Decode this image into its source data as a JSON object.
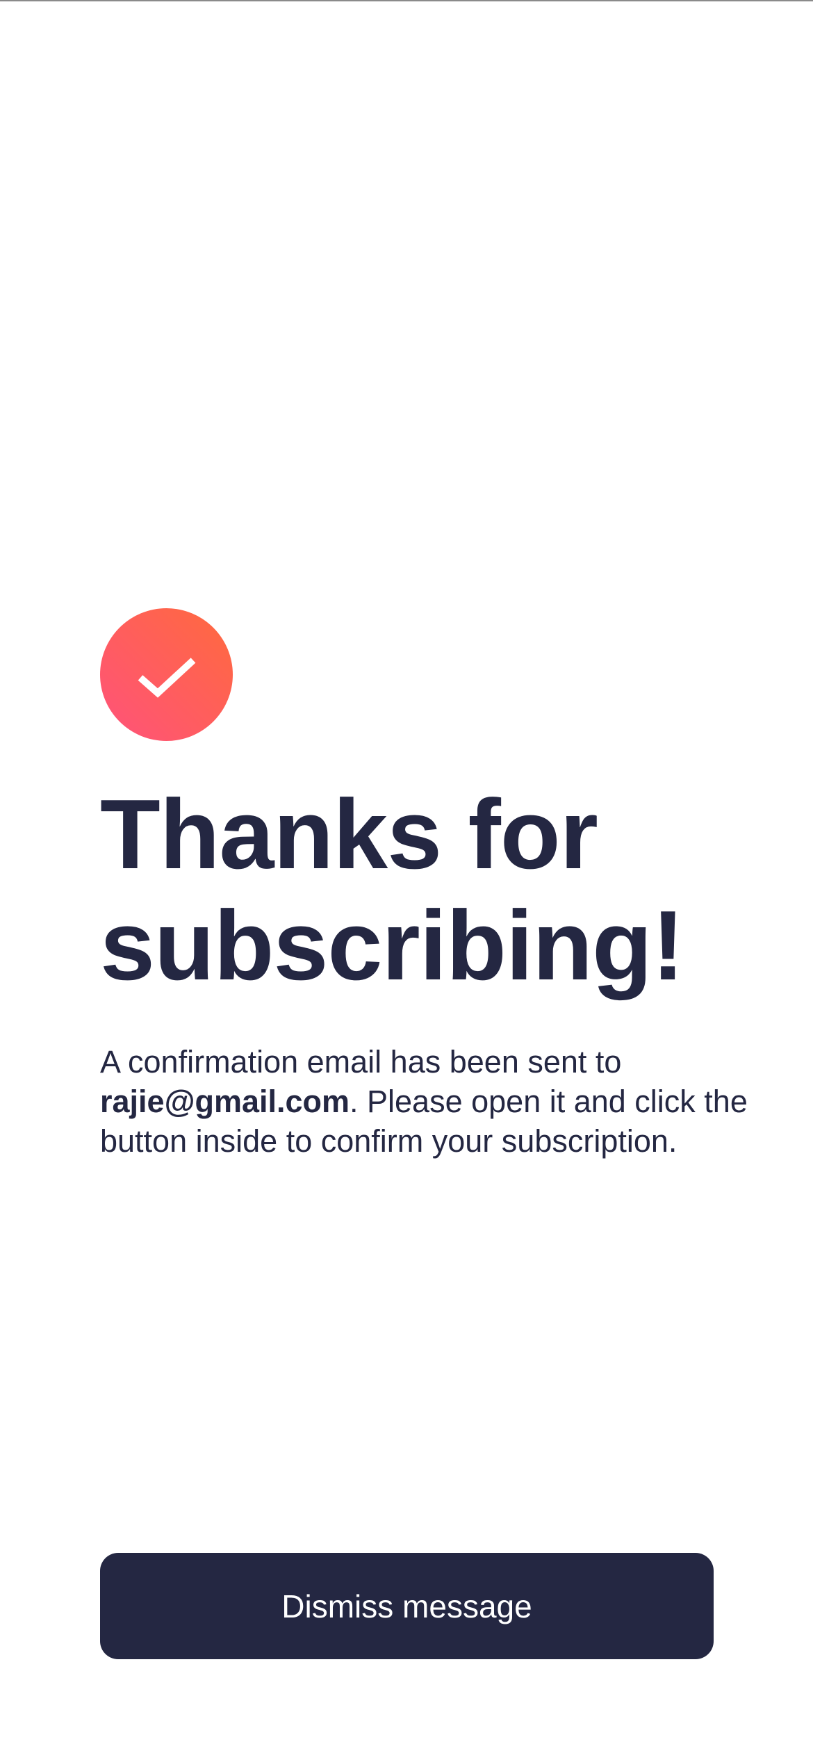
{
  "confirmation": {
    "icon": "checkmark-icon",
    "title": "Thanks for subscribing!",
    "message_before_email": "A confirmation email has been sent to ",
    "email": "rajie@gmail.com",
    "message_after_email": ". Please open it and click the button inside to confirm your subscription.",
    "dismiss_label": "Dismiss message"
  },
  "colors": {
    "primary_dark": "#242742",
    "gradient_start": "#ff6a3d",
    "gradient_end": "#ff527b",
    "background": "#ffffff"
  }
}
